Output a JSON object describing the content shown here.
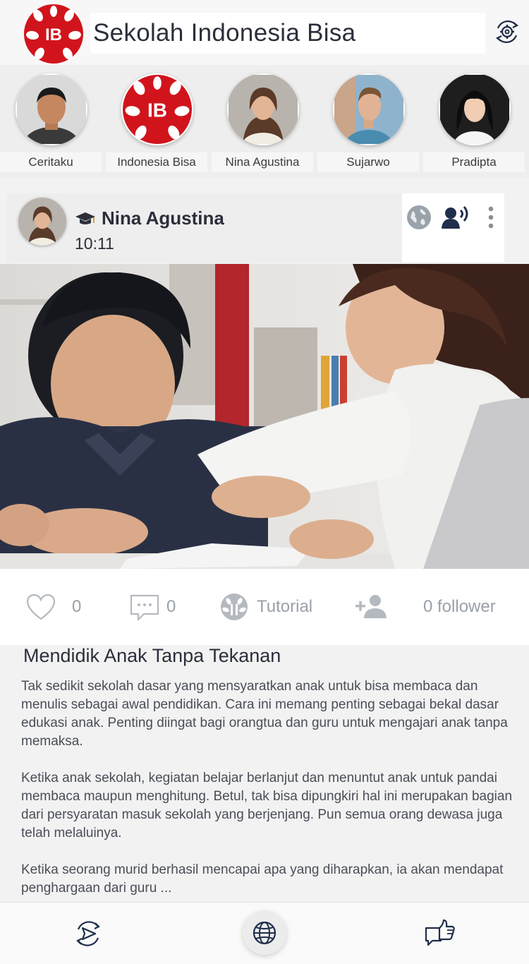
{
  "header": {
    "title": "Sekolah Indonesia Bisa",
    "logo_text": "IB",
    "brand_color": "#d1141c",
    "settings_icon": "gear-sync-icon"
  },
  "stories": [
    {
      "label": "Ceritaku",
      "avatar": "man-avatar"
    },
    {
      "label": "Indonesia Bisa",
      "avatar": "ib-logo"
    },
    {
      "label": "Nina Agustina",
      "avatar": "woman-avatar"
    },
    {
      "label": "Sujarwo",
      "avatar": "man-avatar"
    },
    {
      "label": "Pradipta",
      "avatar": "woman-avatar"
    }
  ],
  "post": {
    "author": "Nina Agustina",
    "time": "10:11",
    "badge_icon": "graduation-cap-icon",
    "actions": [
      "globe-icon",
      "speaker-icon",
      "more-vertical-icon"
    ]
  },
  "stats": {
    "likes": "0",
    "comments": "0",
    "category": "Tutorial",
    "followers": "0 follower"
  },
  "article": {
    "title": "Mendidik Anak Tanpa Tekanan",
    "paragraphs": [
      "Tak sedikit sekolah dasar yang mensyaratkan anak untuk bisa membaca dan menulis sebagai awal pendidikan. Cara ini memang penting sebagai bekal dasar edukasi anak. Penting diingat bagi orangtua dan guru untuk mengajari anak tanpa memaksa.",
      "Ketika anak sekolah, kegiatan belajar berlanjut dan menuntut anak untuk pandai membaca maupun menghitung. Betul, tak bisa dipungkiri hal ini merupakan bagian dari persyaratan masuk sekolah yang berjenjang. Pun semua orang dewasa juga telah melaluinya.",
      "Ketika seorang murid berhasil mencapai apa yang diharapkan, ia akan mendapat penghargaan dari guru ..."
    ]
  },
  "bottom_nav": [
    "share-send-icon",
    "globe-icon",
    "like-chat-icon"
  ]
}
